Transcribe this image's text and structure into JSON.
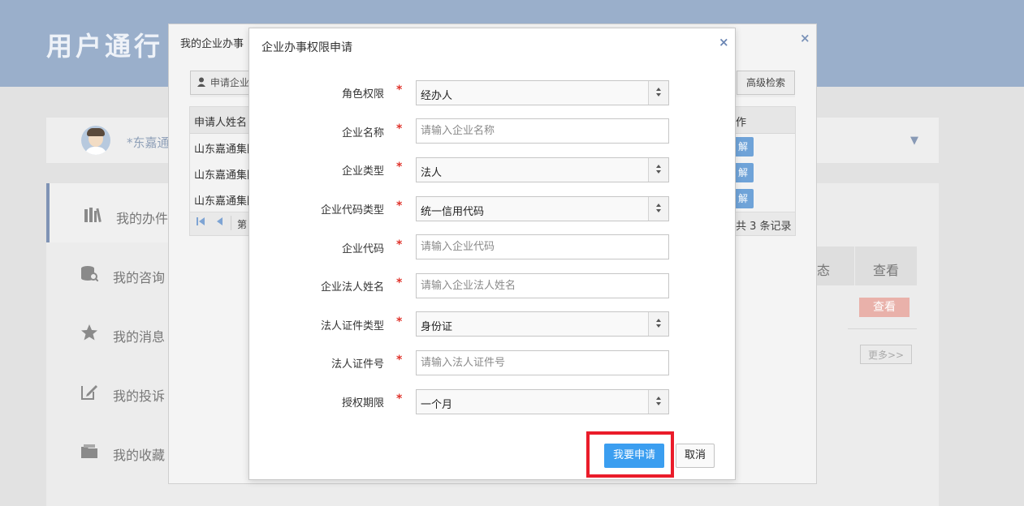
{
  "background": {
    "header_title": "用户通行",
    "username": "*东嘉通",
    "sidebar": [
      {
        "label": "我的办件",
        "icon": "books-icon"
      },
      {
        "label": "我的咨询",
        "icon": "database-search-icon"
      },
      {
        "label": "我的消息",
        "icon": "star-icon"
      },
      {
        "label": "我的投诉",
        "icon": "edit-note-icon"
      },
      {
        "label": "我的收藏",
        "icon": "folder-icon"
      }
    ],
    "columns": [
      "态",
      "查看"
    ],
    "view_button": "查看",
    "more_button": "更多>>"
  },
  "outer_dialog": {
    "title": "我的企业办事",
    "apply_button": "申请企业",
    "advanced_search": "高级检索",
    "grid": {
      "header_name": "申请人姓名",
      "header_op": "作",
      "rows": [
        {
          "name": "山东嘉通集团",
          "op": "解"
        },
        {
          "name": "山东嘉通集团",
          "op": "解"
        },
        {
          "name": "山东嘉通集团",
          "op": "解"
        }
      ],
      "pager_label": "第",
      "total_text": "共 3 条记录"
    }
  },
  "dialog": {
    "title": "企业办事权限申请",
    "required_mark": "*",
    "fields": {
      "role": {
        "label": "角色权限",
        "value": "经办人"
      },
      "company_name": {
        "label": "企业名称",
        "placeholder": "请输入企业名称"
      },
      "company_type": {
        "label": "企业类型",
        "value": "法人"
      },
      "code_type": {
        "label": "企业代码类型",
        "value": "统一信用代码"
      },
      "company_code": {
        "label": "企业代码",
        "placeholder": "请输入企业代码"
      },
      "legal_name": {
        "label": "企业法人姓名",
        "placeholder": "请输入企业法人姓名"
      },
      "id_type": {
        "label": "法人证件类型",
        "value": "身份证"
      },
      "id_number": {
        "label": "法人证件号",
        "placeholder": "请输入法人证件号"
      },
      "auth_period": {
        "label": "授权期限",
        "value": "一个月"
      }
    },
    "submit_label": "我要申请",
    "cancel_label": "取消"
  },
  "colors": {
    "primary": "#3b9ef0",
    "highlight": "#ea1c2a",
    "required": "#e0332b"
  }
}
